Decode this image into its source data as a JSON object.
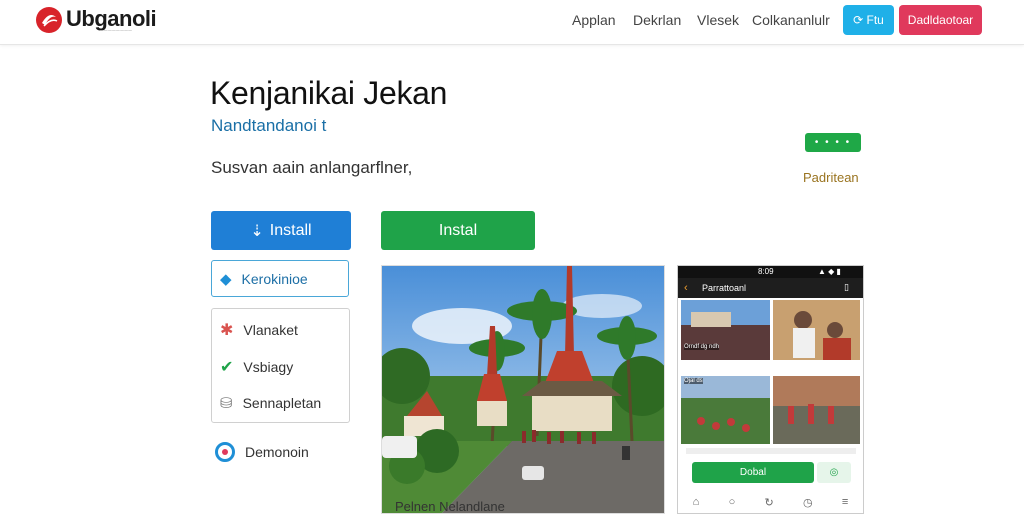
{
  "header": {
    "logo_text": "Ubganoli",
    "nav": [
      "Applan",
      "Dekrlan",
      "Vlesek",
      "Colkananlulr"
    ],
    "btn_blue": "Ftu",
    "btn_red": "Dadldaotoar"
  },
  "hero": {
    "title": "Kenjanikai Jekan",
    "subtitle": "Nandtandanoi t",
    "description": "Susvan aain anlangarflner,",
    "side_badge": "• • • •",
    "side_label": "Padritean"
  },
  "actions": {
    "install_primary": "Install",
    "install_secondary": "Instal",
    "outline_button": "Kerokinioe",
    "list_items": [
      {
        "label": "Vlanaket",
        "icon": "star-icon"
      },
      {
        "label": "Vsbiagy",
        "icon": "checkmark-icon"
      },
      {
        "label": "Sennapletan",
        "icon": "storage-icon"
      }
    ],
    "demo_label": "Demonoin"
  },
  "photo": {
    "caption": "Pelnen Nelandlane"
  },
  "phone": {
    "status_left": "8:09",
    "status_right": "▲ ◆ ▮",
    "bar_title": "Parrattoanl",
    "tiles": [
      "Orndf dg ndh",
      "",
      "Ojal ds",
      ""
    ],
    "green_button": "Dobal",
    "green_small": "◎",
    "nav_icons": [
      "home-icon",
      "search-icon",
      "refresh-icon",
      "clock-icon",
      "menu-icon"
    ]
  },
  "colors": {
    "accent_blue": "#1f7fd6",
    "accent_green": "#1fa349",
    "header_red": "#e0395c",
    "header_cyan": "#1fb0e8"
  }
}
